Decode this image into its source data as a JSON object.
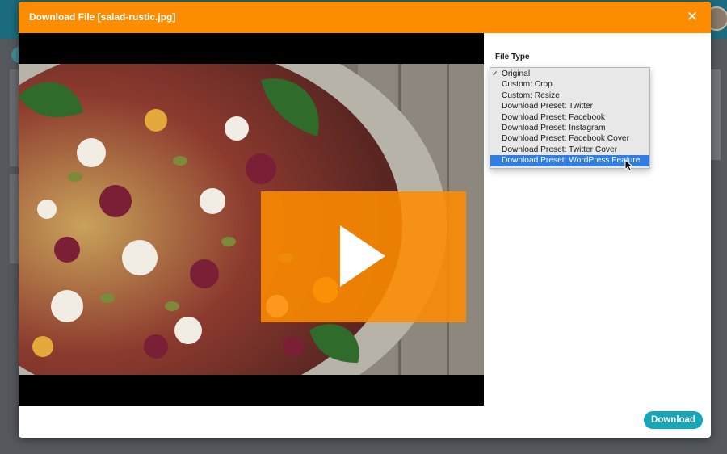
{
  "modal": {
    "title": "Download File [salad-rustic.jpg]",
    "close_icon": "close-icon",
    "header_color": "#fe8c00"
  },
  "preview": {
    "play_icon": "play-icon",
    "play_overlay_color": "#fe8c00"
  },
  "file_type": {
    "label": "File Type",
    "options": [
      {
        "label": "Original",
        "checked": true
      },
      {
        "label": "Custom: Crop"
      },
      {
        "label": "Custom: Resize"
      },
      {
        "label": "Download Preset: Twitter"
      },
      {
        "label": "Download Preset: Facebook"
      },
      {
        "label": "Download Preset: Instagram"
      },
      {
        "label": "Download Preset: Facebook Cover"
      },
      {
        "label": "Download Preset: Twitter Cover"
      },
      {
        "label": "Download Preset: WordPress Feature",
        "highlighted": true
      }
    ],
    "check_glyph": "✓",
    "highlight_color": "#2f7ee0"
  },
  "footer": {
    "download_label": "Download",
    "download_color": "#15a6b8"
  }
}
